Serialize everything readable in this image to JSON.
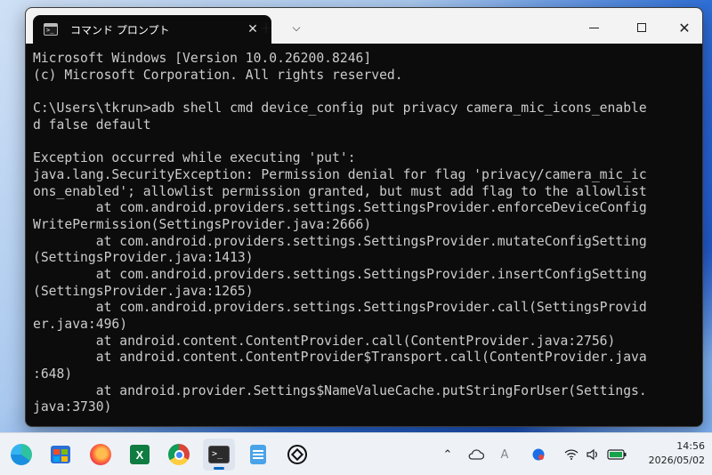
{
  "window": {
    "tab_title": "コマンド プロンプト",
    "tab_close": "✕",
    "new_tab": "+",
    "dropdown": "⌵",
    "close": "✕"
  },
  "console": {
    "lines": [
      "Microsoft Windows [Version 10.0.26200.8246]",
      "(c) Microsoft Corporation. All rights reserved.",
      "",
      "C:\\Users\\tkrun>adb shell cmd device_config put privacy camera_mic_icons_enable",
      "d false default",
      "",
      "Exception occurred while executing 'put':",
      "java.lang.SecurityException: Permission denial for flag 'privacy/camera_mic_ic",
      "ons_enabled'; allowlist permission granted, but must add flag to the allowlist",
      "        at com.android.providers.settings.SettingsProvider.enforceDeviceConfig",
      "WritePermission(SettingsProvider.java:2666)",
      "        at com.android.providers.settings.SettingsProvider.mutateConfigSetting",
      "(SettingsProvider.java:1413)",
      "        at com.android.providers.settings.SettingsProvider.insertConfigSetting",
      "(SettingsProvider.java:1265)",
      "        at com.android.providers.settings.SettingsProvider.call(SettingsProvid",
      "er.java:496)",
      "        at android.content.ContentProvider.call(ContentProvider.java:2756)",
      "        at android.content.ContentProvider$Transport.call(ContentProvider.java",
      ":648)",
      "        at android.provider.Settings$NameValueCache.putStringForUser(Settings.",
      "java:3730)"
    ]
  },
  "taskbar": {
    "apps": [
      {
        "icon": "edge-icon",
        "label": "Microsoft Edge"
      },
      {
        "icon": "store-icon",
        "label": "Microsoft Store"
      },
      {
        "icon": "firefox-icon",
        "label": "Firefox"
      },
      {
        "icon": "excel-icon",
        "label": "Excel",
        "glyph": "X"
      },
      {
        "icon": "chrome-icon",
        "label": "Google Chrome"
      },
      {
        "icon": "terminal-icon",
        "label": "Terminal",
        "glyph": ">_",
        "active": true
      },
      {
        "icon": "notepad-icon",
        "label": "Notepad"
      },
      {
        "icon": "chatgpt-icon",
        "label": "ChatGPT"
      }
    ],
    "tray": {
      "chevron": "⌃",
      "ime": "A",
      "time": "14:56",
      "date": "2026/05/02"
    }
  },
  "colors": {
    "console_bg": "#0c0c0c",
    "console_text": "#cccccc",
    "titlebar_bg": "#f3f3f3",
    "taskbar_bg": "#eef2f7",
    "accent": "#0067c0"
  }
}
